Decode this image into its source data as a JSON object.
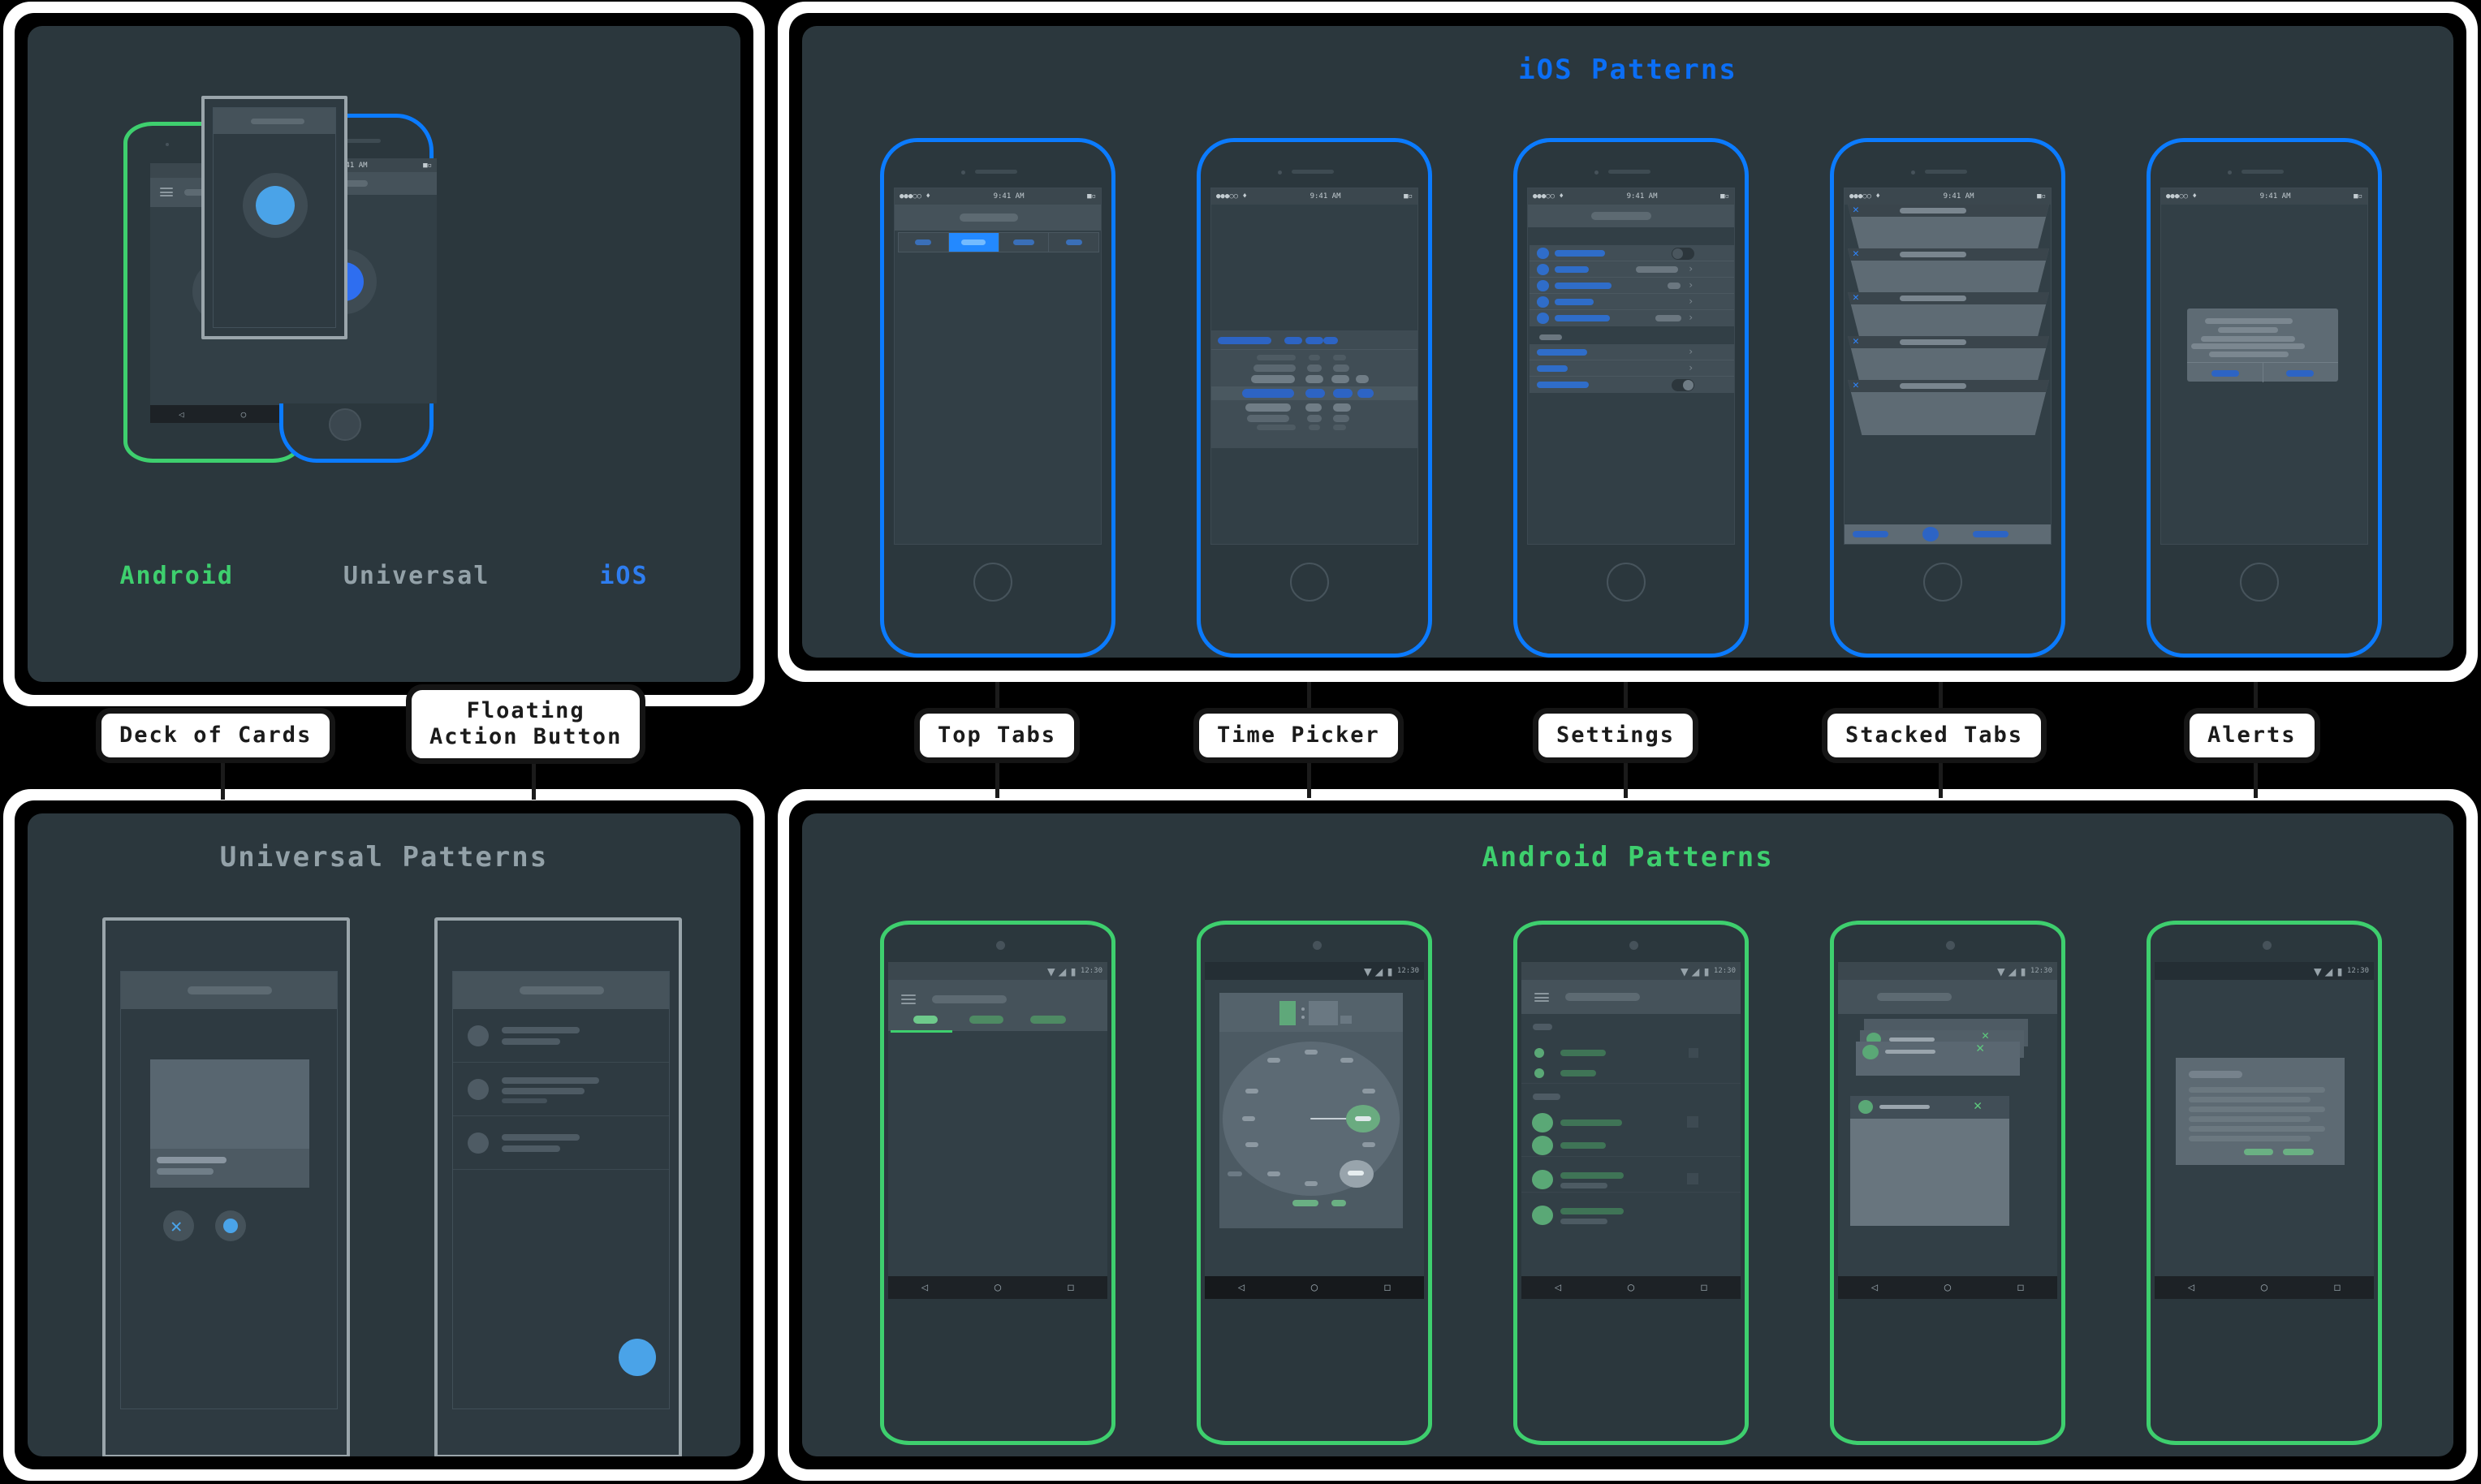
{
  "panels": {
    "deck": {
      "name": "Deck of Cards panel",
      "platform_labels": [
        {
          "text": "Android",
          "color": "#3ecf6e"
        },
        {
          "text": "Universal",
          "color": "#93a1a8"
        },
        {
          "text": "iOS",
          "color": "#2e7df0"
        }
      ]
    },
    "ios": {
      "title": "iOS Patterns",
      "title_color": "#0b6ef5"
    },
    "universal": {
      "title": "Universal Patterns",
      "title_color": "#93a1a8"
    },
    "android": {
      "title": "Android Patterns",
      "title_color": "#3ecf6e"
    }
  },
  "chips": [
    {
      "id": "deck-of-cards",
      "label": "Deck of Cards"
    },
    {
      "id": "floating-action-button",
      "label": "Floating\nAction Button"
    },
    {
      "id": "top-tabs",
      "label": "Top Tabs"
    },
    {
      "id": "time-picker",
      "label": "Time Picker"
    },
    {
      "id": "settings",
      "label": "Settings"
    },
    {
      "id": "stacked-tabs",
      "label": "Stacked Tabs"
    },
    {
      "id": "alerts",
      "label": "Alerts"
    }
  ],
  "status_bars": {
    "ios_time": "9:41 AM",
    "android_time": "12:30"
  },
  "colors": {
    "background": "#000000",
    "frame": "#ffffff",
    "panel": "#2b373d",
    "screen": "#323f46",
    "android_accent": "#3ecf6e",
    "ios_accent": "#0b7bff",
    "universal_accent": "#4aa3e8",
    "chrome": "#45525a",
    "status": "#3b474e",
    "nav": "#1d2226",
    "placeholder": "#5d6a72",
    "text_muted": "#8e9aa1"
  },
  "screens": {
    "ios": [
      {
        "id": "top-tabs",
        "pattern": "segmented-control",
        "segments": 4,
        "selected_index": 1
      },
      {
        "id": "time-picker",
        "pattern": "wheel-picker",
        "columns": 4,
        "selected_row": 3
      },
      {
        "id": "settings",
        "pattern": "settings-list",
        "group1_rows": 5,
        "group2_rows": 3,
        "toggles": 2,
        "chevrons": 5
      },
      {
        "id": "stacked-tabs",
        "pattern": "stacked-cards",
        "cards": 5,
        "toolbar_items": 3
      },
      {
        "id": "alerts",
        "pattern": "alert-dialog",
        "text_lines": 5,
        "buttons": 2
      }
    ],
    "android": [
      {
        "id": "top-tabs",
        "pattern": "tab-bar",
        "tabs": 3,
        "selected_index": 0
      },
      {
        "id": "time-picker",
        "pattern": "clock-dial",
        "ticks": 12
      },
      {
        "id": "settings",
        "pattern": "settings-list",
        "sections": 4,
        "rows": 7
      },
      {
        "id": "stacked-tabs",
        "pattern": "stacked-cards",
        "cards": 4
      },
      {
        "id": "alerts",
        "pattern": "alert-dialog",
        "text_lines": 6,
        "buttons": 2
      }
    ],
    "universal": [
      {
        "id": "card-dialog",
        "pattern": "image-card-dialog",
        "actions": 2
      },
      {
        "id": "list-fab",
        "pattern": "list-with-fab",
        "rows": 3
      }
    ],
    "deck": [
      {
        "id": "android-card",
        "accent": "#4dc06f"
      },
      {
        "id": "universal-card",
        "accent": "#4aa3e8"
      },
      {
        "id": "ios-card",
        "accent": "#2e6ef0"
      }
    ]
  }
}
